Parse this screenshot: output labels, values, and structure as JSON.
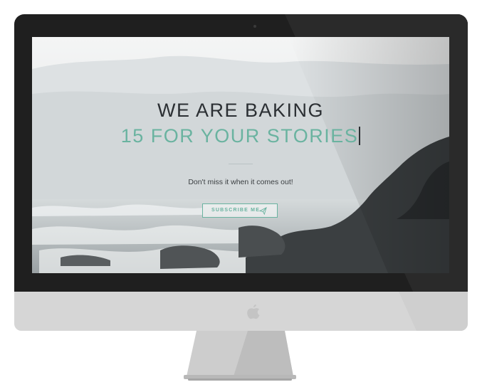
{
  "hero": {
    "headline_line1": "WE ARE BAKING",
    "headline_line2": "15 FOR YOUR STORIES",
    "tagline": "Don't miss it when it comes out!",
    "subscribe_label": "SUBSCRIBE ME"
  },
  "colors": {
    "accent": "#6ab3a0",
    "heading": "#2b2f33",
    "bezel": "#1f1f1f",
    "chin": "#d6d6d6"
  },
  "icons": {
    "send": "paper-plane-icon",
    "brand": "apple-logo-icon",
    "camera": "camera-dot"
  }
}
